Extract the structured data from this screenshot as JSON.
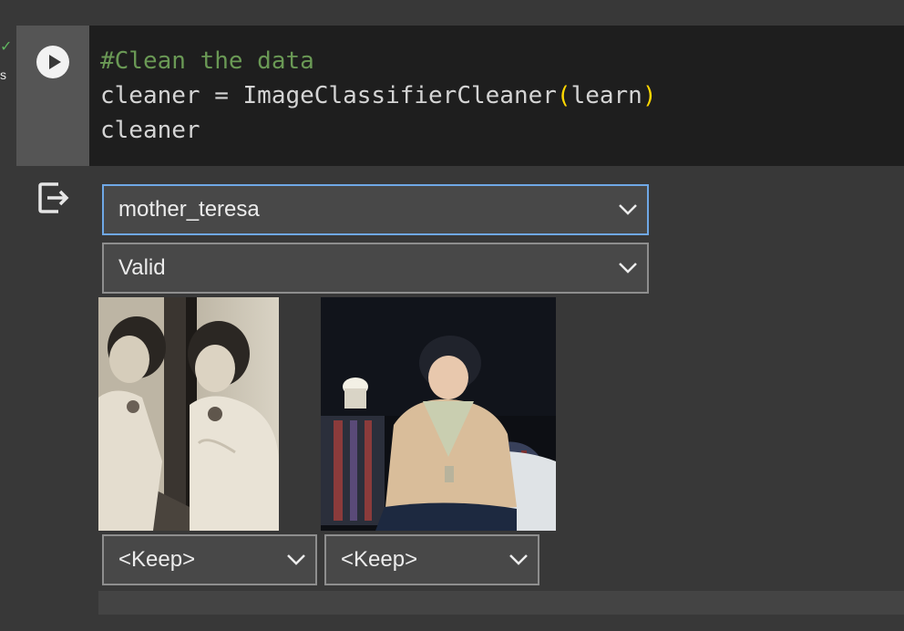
{
  "cell": {
    "status_check": "✓",
    "status_suffix": "s",
    "run_icon": "play-icon",
    "code_lines": [
      {
        "comment": "#Clean the data"
      },
      {
        "pre": "cleaner = ImageClassifierCleaner",
        "open": "(",
        "arg": "learn",
        "close": ")"
      },
      {
        "text": "cleaner"
      }
    ]
  },
  "output": {
    "icon": "output-redirect-icon",
    "class_select": {
      "value": "mother_teresa"
    },
    "split_select": {
      "value": "Valid"
    },
    "images": [
      {
        "icon": "photo-icon",
        "action": "<Keep>"
      },
      {
        "icon": "photo-icon",
        "action": "<Keep>"
      }
    ]
  },
  "colors": {
    "background": "#383838",
    "code_bg": "#1e1e1e",
    "comment": "#6a9955",
    "paren": "#ffd700",
    "focus_border": "#6fa8e6"
  }
}
